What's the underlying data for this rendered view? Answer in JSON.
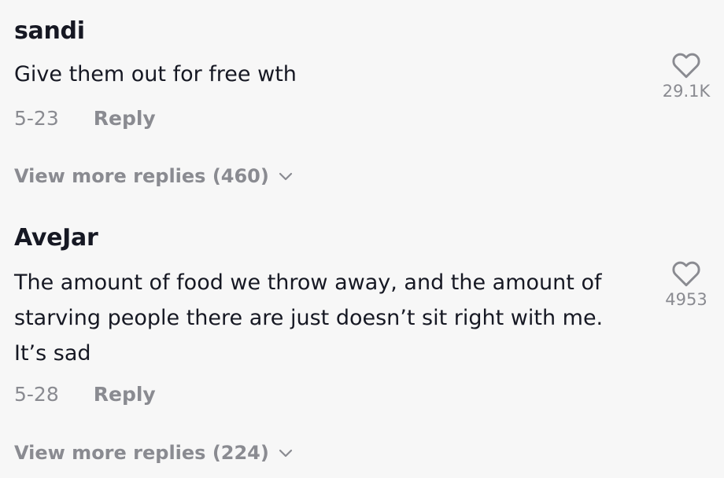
{
  "comments": [
    {
      "username": "sandi",
      "text": "Give them out for free wth",
      "date": "5-23",
      "reply_label": "Reply",
      "view_more_label": "View more replies (460)",
      "like_count": "29.1K"
    },
    {
      "username": "AveJar",
      "text": "The amount of food we throw away, and the amount of starving people there are just doesn’t sit right with me. It’s sad",
      "date": "5-28",
      "reply_label": "Reply",
      "view_more_label": "View more replies (224)",
      "like_count": "4953"
    }
  ],
  "icons": {
    "like": "heart-outline-icon",
    "expand": "chevron-down-icon"
  },
  "colors": {
    "background": "#f7f7f7",
    "primary_text": "#161823",
    "secondary_text": "#8a8b91"
  }
}
